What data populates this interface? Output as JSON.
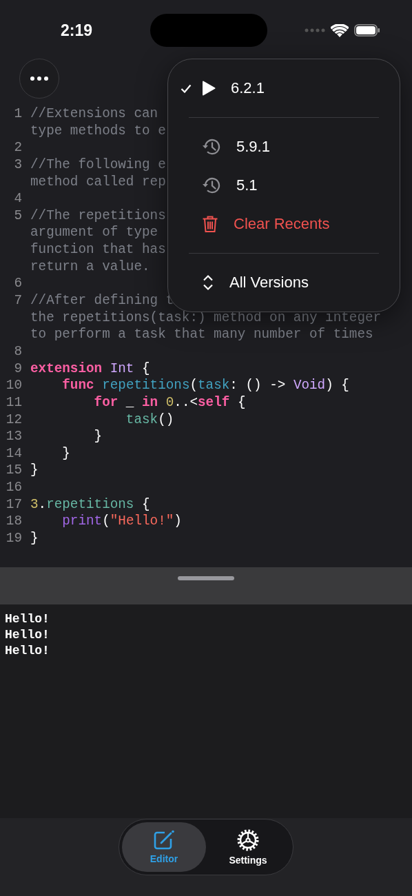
{
  "status_bar": {
    "time": "2:19"
  },
  "editor": {
    "lines": [
      {
        "number": "1",
        "rows": [
          [
            {
              "text": "//Extensions can",
              "kind": "comment"
            }
          ],
          [
            {
              "text": "type methods to e",
              "kind": "comment"
            }
          ]
        ]
      },
      {
        "number": "2",
        "rows": [
          []
        ]
      },
      {
        "number": "3",
        "rows": [
          [
            {
              "text": "//The following e",
              "kind": "comment"
            }
          ],
          [
            {
              "text": "method called rep",
              "kind": "comment"
            }
          ]
        ]
      },
      {
        "number": "4",
        "rows": [
          []
        ]
      },
      {
        "number": "5",
        "rows": [
          [
            {
              "text": "//The repetitions",
              "kind": "comment"
            }
          ],
          [
            {
              "text": "argument of type",
              "kind": "comment"
            }
          ],
          [
            {
              "text": "function that has",
              "kind": "comment"
            }
          ],
          [
            {
              "text": "return a value.",
              "kind": "comment"
            }
          ]
        ]
      },
      {
        "number": "6",
        "rows": [
          []
        ]
      },
      {
        "number": "7",
        "rows": [
          [
            {
              "text": "//After defining t",
              "kind": "comment"
            }
          ],
          [
            {
              "text": "the repetitions(task:) method on any integer",
              "kind": "comment"
            }
          ],
          [
            {
              "text": "to perform a task that many number of times",
              "kind": "comment"
            }
          ]
        ]
      },
      {
        "number": "8",
        "rows": [
          []
        ]
      },
      {
        "number": "9",
        "rows": [
          [
            {
              "text": "extension",
              "kind": "keyword"
            },
            {
              "text": " ",
              "kind": "plain"
            },
            {
              "text": "Int",
              "kind": "type"
            },
            {
              "text": " {",
              "kind": "plain"
            }
          ]
        ]
      },
      {
        "number": "10",
        "rows": [
          [
            {
              "text": "    ",
              "kind": "plain"
            },
            {
              "text": "func",
              "kind": "keyword"
            },
            {
              "text": " ",
              "kind": "plain"
            },
            {
              "text": "repetitions",
              "kind": "declaration"
            },
            {
              "text": "(",
              "kind": "plain"
            },
            {
              "text": "task",
              "kind": "declaration"
            },
            {
              "text": ": () -> ",
              "kind": "plain"
            },
            {
              "text": "Void",
              "kind": "type"
            },
            {
              "text": ") {",
              "kind": "plain"
            }
          ]
        ]
      },
      {
        "number": "11",
        "rows": [
          [
            {
              "text": "        ",
              "kind": "plain"
            },
            {
              "text": "for",
              "kind": "keyword"
            },
            {
              "text": " _ ",
              "kind": "plain"
            },
            {
              "text": "in",
              "kind": "keyword"
            },
            {
              "text": " ",
              "kind": "plain"
            },
            {
              "text": "0",
              "kind": "number"
            },
            {
              "text": "..<",
              "kind": "plain"
            },
            {
              "text": "self",
              "kind": "keyword"
            },
            {
              "text": " {",
              "kind": "plain"
            }
          ]
        ]
      },
      {
        "number": "12",
        "rows": [
          [
            {
              "text": "            ",
              "kind": "plain"
            },
            {
              "text": "task",
              "kind": "call"
            },
            {
              "text": "()",
              "kind": "plain"
            }
          ]
        ]
      },
      {
        "number": "13",
        "rows": [
          [
            {
              "text": "        }",
              "kind": "plain"
            }
          ]
        ]
      },
      {
        "number": "14",
        "rows": [
          [
            {
              "text": "    }",
              "kind": "plain"
            }
          ]
        ]
      },
      {
        "number": "15",
        "rows": [
          [
            {
              "text": "}",
              "kind": "plain"
            }
          ]
        ]
      },
      {
        "number": "16",
        "rows": [
          []
        ]
      },
      {
        "number": "17",
        "rows": [
          [
            {
              "text": "3",
              "kind": "number"
            },
            {
              "text": ".",
              "kind": "plain"
            },
            {
              "text": "repetitions",
              "kind": "call"
            },
            {
              "text": " {",
              "kind": "plain"
            }
          ]
        ]
      },
      {
        "number": "18",
        "rows": [
          [
            {
              "text": "    ",
              "kind": "plain"
            },
            {
              "text": "print",
              "kind": "builtin"
            },
            {
              "text": "(",
              "kind": "plain"
            },
            {
              "text": "\"Hello!\"",
              "kind": "string"
            },
            {
              "text": ")",
              "kind": "plain"
            }
          ]
        ]
      },
      {
        "number": "19",
        "rows": [
          [
            {
              "text": "}",
              "kind": "plain"
            }
          ]
        ]
      }
    ]
  },
  "version_menu": {
    "items": [
      {
        "kind": "current",
        "label": "6.2.1",
        "selected": true
      },
      {
        "kind": "separator"
      },
      {
        "kind": "recent",
        "label": "5.9.1"
      },
      {
        "kind": "recent",
        "label": "5.1"
      },
      {
        "kind": "destructive",
        "label": "Clear Recents"
      },
      {
        "kind": "separator"
      },
      {
        "kind": "all",
        "label": "All Versions"
      }
    ]
  },
  "output": {
    "lines": [
      "Hello!",
      "Hello!",
      "Hello!"
    ]
  },
  "tabs": [
    {
      "label": "Editor",
      "kind": "editor",
      "selected": true
    },
    {
      "label": "Settings",
      "kind": "settings",
      "selected": false
    }
  ]
}
